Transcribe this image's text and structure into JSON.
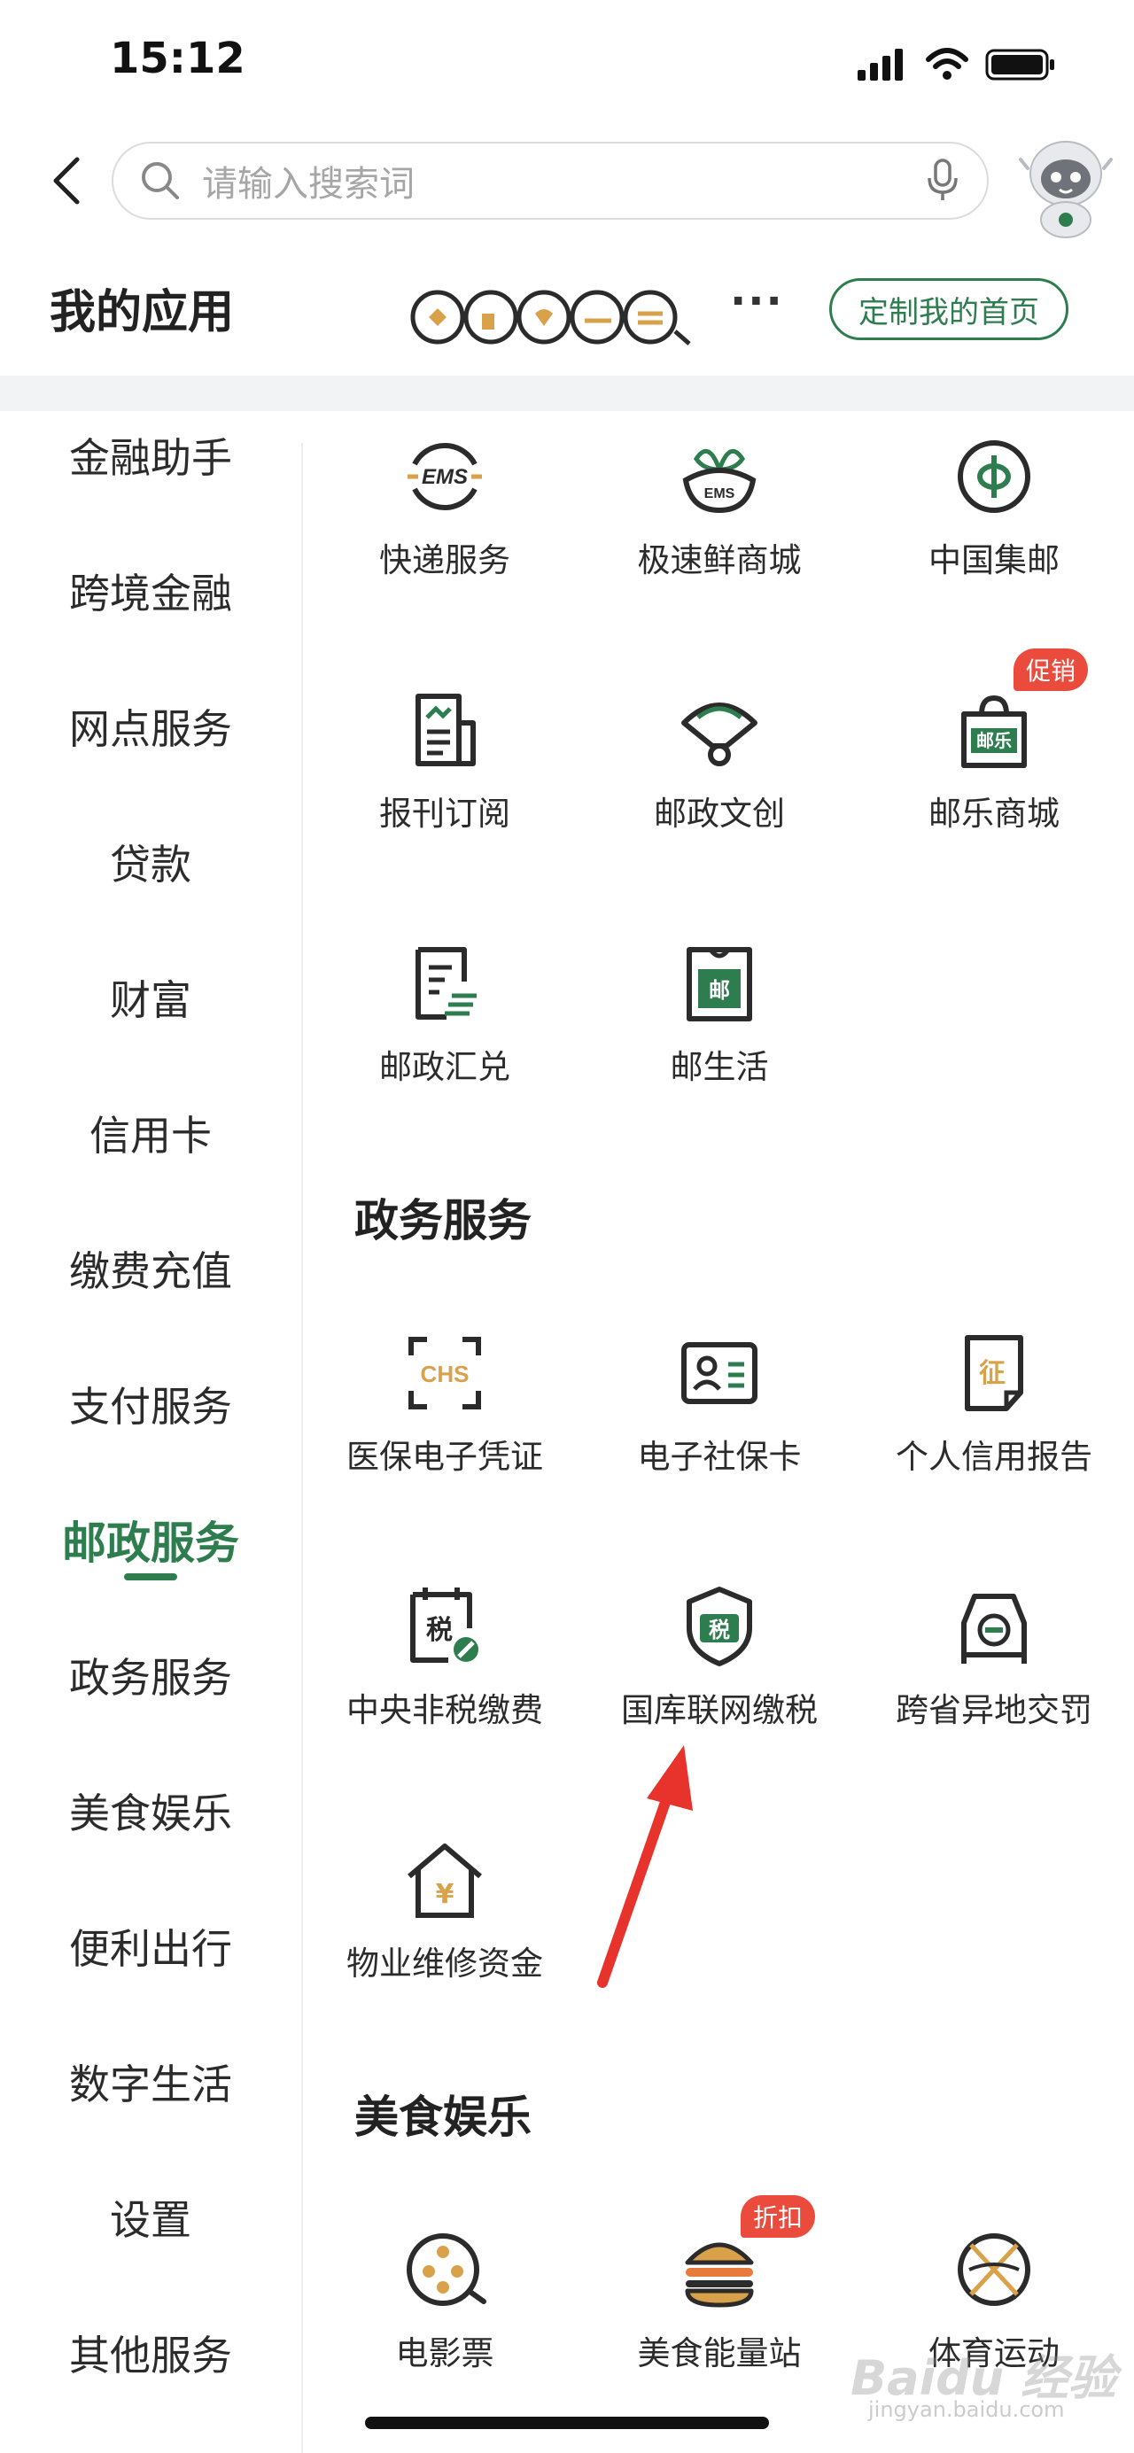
{
  "status": {
    "time": "15:12"
  },
  "search": {
    "placeholder": "请输入搜索词"
  },
  "header": {
    "title": "我的应用",
    "more": "···",
    "customize_label": "定制我的首页"
  },
  "sidebar": {
    "items": [
      {
        "label": "金融助手",
        "active": false
      },
      {
        "label": "跨境金融",
        "active": false
      },
      {
        "label": "网点服务",
        "active": false
      },
      {
        "label": "贷款",
        "active": false
      },
      {
        "label": "财富",
        "active": false
      },
      {
        "label": "信用卡",
        "active": false
      },
      {
        "label": "缴费充值",
        "active": false
      },
      {
        "label": "支付服务",
        "active": false
      },
      {
        "label": "邮政服务",
        "active": true
      },
      {
        "label": "政务服务",
        "active": false
      },
      {
        "label": "美食娱乐",
        "active": false
      },
      {
        "label": "便利出行",
        "active": false
      },
      {
        "label": "数字生活",
        "active": false
      },
      {
        "label": "设置",
        "active": false
      },
      {
        "label": "其他服务",
        "active": false
      }
    ]
  },
  "postal": {
    "items": [
      {
        "label": "快递服务",
        "icon": "ems-icon"
      },
      {
        "label": "极速鲜商城",
        "icon": "ems-fresh-icon"
      },
      {
        "label": "中国集邮",
        "icon": "stamp-collection-icon"
      },
      {
        "label": "报刊订阅",
        "icon": "newspaper-icon"
      },
      {
        "label": "邮政文创",
        "icon": "fan-icon"
      },
      {
        "label": "邮乐商城",
        "icon": "shopping-bag-icon",
        "badge": "促销",
        "bag_text": "邮乐"
      },
      {
        "label": "邮政汇兑",
        "icon": "remittance-icon"
      },
      {
        "label": "邮生活",
        "icon": "post-life-icon",
        "bag_text": "邮"
      }
    ]
  },
  "gov": {
    "title": "政务服务",
    "items": [
      {
        "label": "医保电子凭证",
        "icon": "chs-icon",
        "icon_text": "CHS"
      },
      {
        "label": "电子社保卡",
        "icon": "id-card-icon"
      },
      {
        "label": "个人信用报告",
        "icon": "credit-report-icon",
        "icon_text": "征"
      },
      {
        "label": "中央非税缴费",
        "icon": "tax-payment-icon",
        "icon_text": "税"
      },
      {
        "label": "国库联网缴税",
        "icon": "tax-shield-icon",
        "icon_text": "税"
      },
      {
        "label": "跨省异地交罚",
        "icon": "car-fine-icon"
      },
      {
        "label": "物业维修资金",
        "icon": "house-icon",
        "icon_text": "¥"
      }
    ]
  },
  "food": {
    "title": "美食娱乐",
    "items": [
      {
        "label": "电影票",
        "icon": "film-reel-icon"
      },
      {
        "label": "美食能量站",
        "icon": "burger-icon",
        "badge": "折扣"
      },
      {
        "label": "体育运动",
        "icon": "basketball-icon"
      }
    ]
  },
  "watermark": {
    "text": "Baidu 经验",
    "sub": "jingyan.baidu.com"
  },
  "colors": {
    "brand_green": "#2e7d4f",
    "accent_gold": "#d9a14a",
    "badge_red": "#ea4b3c",
    "arrow_red": "#e8322c"
  }
}
